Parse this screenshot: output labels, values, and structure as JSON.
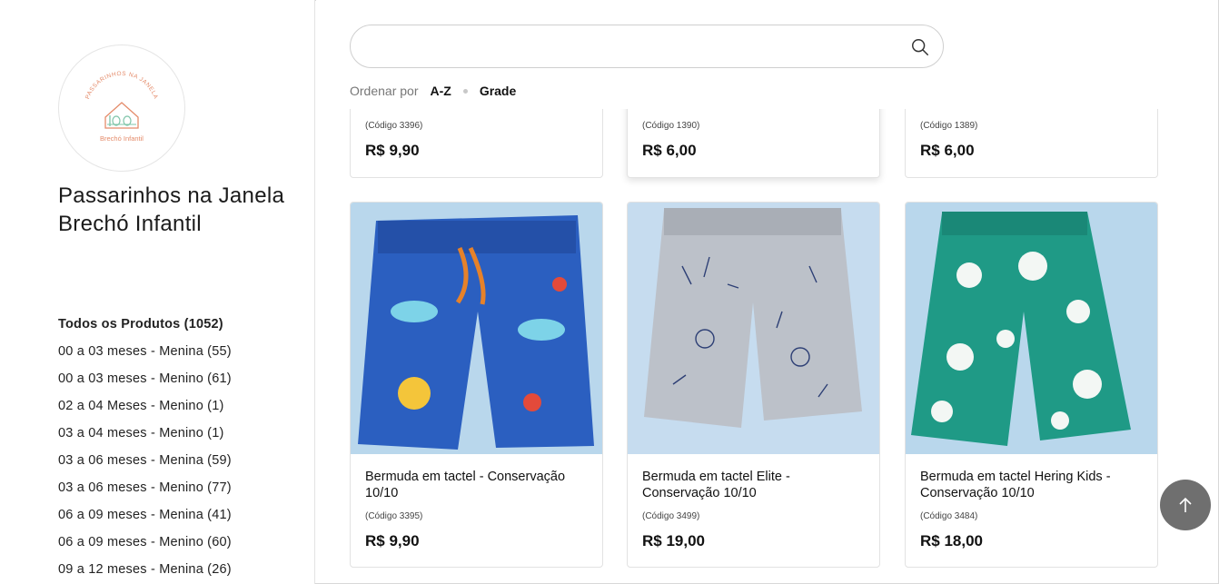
{
  "store": {
    "name": "Passarinhos na Janela Brechó Infantil",
    "logo_text_top": "PASSARINHOS NA JANELA",
    "logo_text_bottom": "Brechó Infantil"
  },
  "categories": [
    {
      "label": "Todos os Produtos (1052)",
      "active": true
    },
    {
      "label": "00 a 03 meses - Menina (55)"
    },
    {
      "label": "00 a 03 meses - Menino (61)"
    },
    {
      "label": "02 a 04 Meses - Menino (1)"
    },
    {
      "label": "03 a 04 meses - Menino (1)"
    },
    {
      "label": "03 a 06 meses - Menina (59)"
    },
    {
      "label": "03 a 06 meses - Menino (77)"
    },
    {
      "label": "06 a 09 meses - Menina (41)"
    },
    {
      "label": "06 a 09 meses - Menino (60)"
    },
    {
      "label": "09 a 12 meses - Menina (26)"
    }
  ],
  "search": {
    "placeholder": "",
    "value": ""
  },
  "sort": {
    "label": "Ordenar por",
    "order": "A-Z",
    "view": "Grade"
  },
  "products_top": [
    {
      "code": "(Código 3396)",
      "price": "R$ 9,90"
    },
    {
      "code": "(Código 1390)",
      "price": "R$ 6,00"
    },
    {
      "code": "(Código 1389)",
      "price": "R$ 6,00"
    }
  ],
  "products": [
    {
      "title": "Bermuda em tactel - Conservação 10/10",
      "code": "(Código 3395)",
      "price": "R$ 9,90",
      "color": "#2b5fc0"
    },
    {
      "title": "Bermuda em tactel Elite - Conservação 10/10",
      "code": "(Código 3499)",
      "price": "R$ 19,00",
      "color": "#b9bec6"
    },
    {
      "title": "Bermuda em tactel Hering Kids - Conservação 10/10",
      "code": "(Código 3484)",
      "price": "R$ 18,00",
      "color": "#1f9a86"
    }
  ]
}
